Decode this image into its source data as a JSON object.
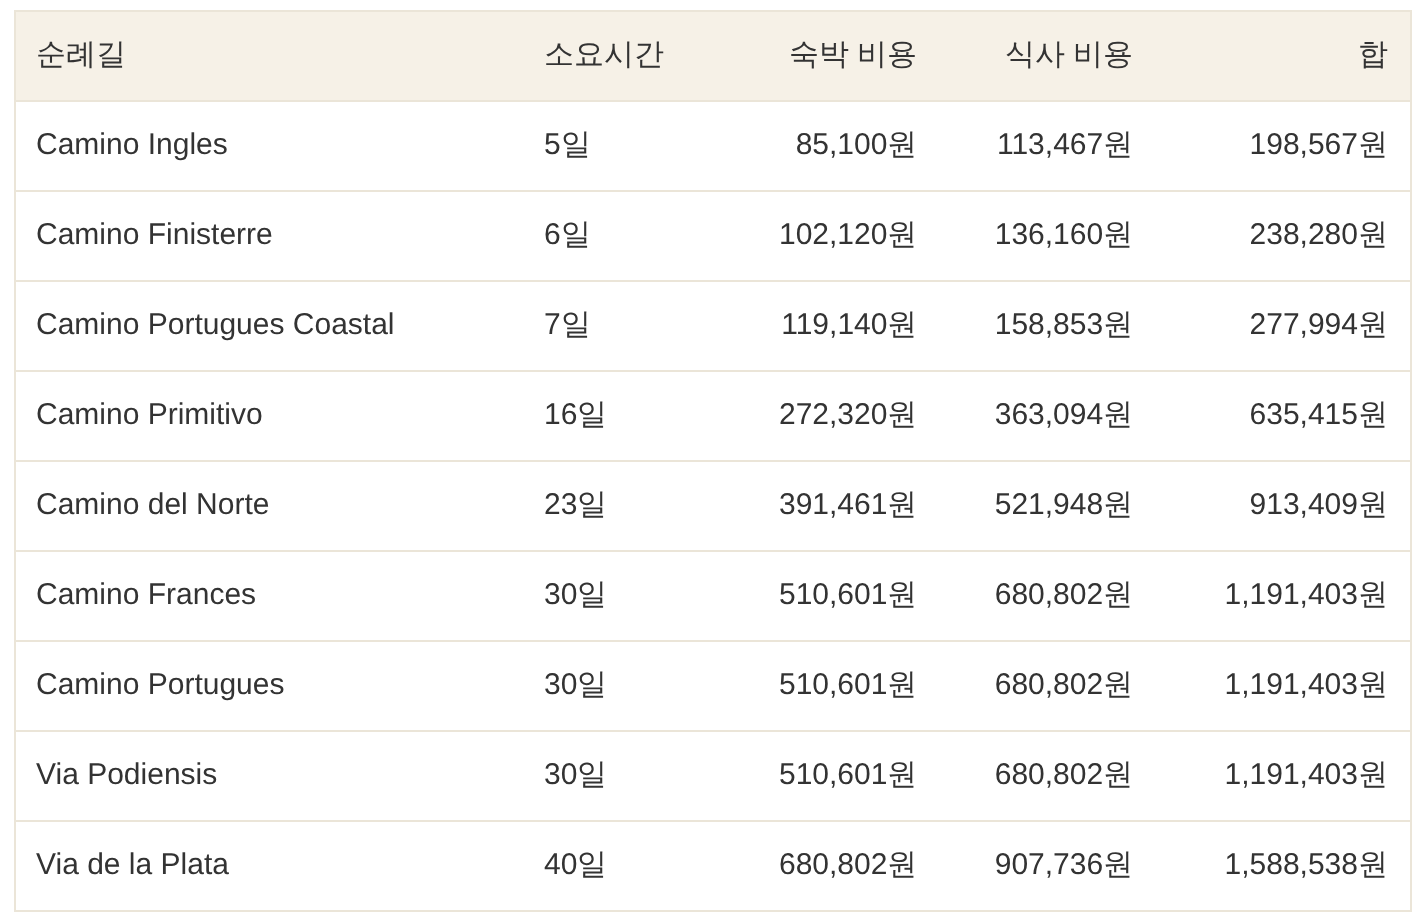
{
  "table": {
    "columns": [
      "순례길",
      "소요시간",
      "숙박 비용",
      "식사 비용",
      "합"
    ],
    "rows": [
      [
        "Camino Ingles",
        "5일",
        "85,100원",
        "113,467원",
        "198,567원"
      ],
      [
        "Camino Finisterre",
        "6일",
        "102,120원",
        "136,160원",
        "238,280원"
      ],
      [
        "Camino Portugues Coastal",
        "7일",
        "119,140원",
        "158,853원",
        "277,994원"
      ],
      [
        "Camino Primitivo",
        "16일",
        "272,320원",
        "363,094원",
        "635,415원"
      ],
      [
        "Camino del Norte",
        "23일",
        "391,461원",
        "521,948원",
        "913,409원"
      ],
      [
        "Camino Frances",
        "30일",
        "510,601원",
        "680,802원",
        "1,191,403원"
      ],
      [
        "Camino Portugues",
        "30일",
        "510,601원",
        "680,802원",
        "1,191,403원"
      ],
      [
        "Via Podiensis",
        "30일",
        "510,601원",
        "680,802원",
        "1,191,403원"
      ],
      [
        "Via de la Plata",
        "40일",
        "680,802원",
        "907,736원",
        "1,588,538원"
      ]
    ]
  }
}
